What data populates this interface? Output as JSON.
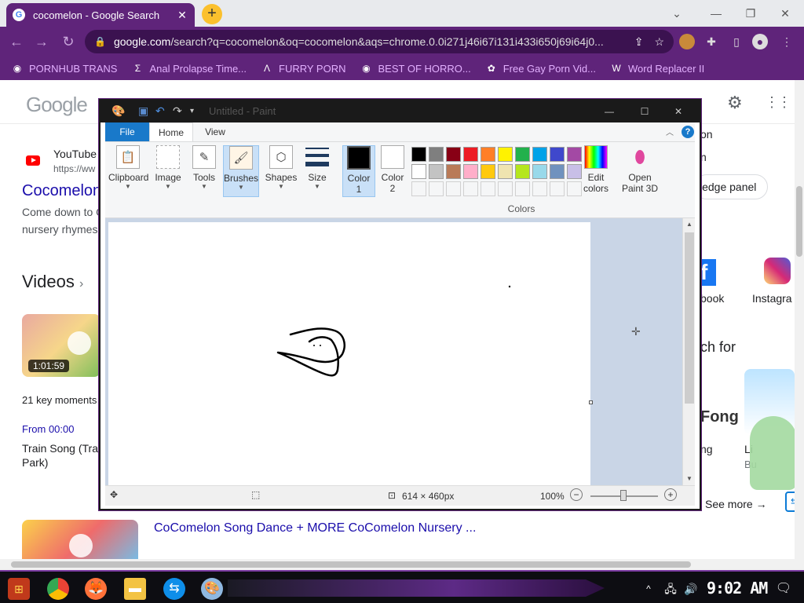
{
  "browser": {
    "tab_title": "cocomelon - Google Search",
    "tab_favicon": "G",
    "url_domain": "google.com",
    "url_path": "/search?q=cocomelon&oq=cocomelon&aqs=chrome.0.0i271j46i67i131i433i650j69i64j0...",
    "accent": "#5f247a"
  },
  "bookmarks": [
    {
      "label": "PORNHUB TRANS",
      "icon": "globe-icon"
    },
    {
      "label": "Anal Prolapse Time...",
      "icon": "sigma-icon"
    },
    {
      "label": "FURRY PORN",
      "icon": "lambda-icon"
    },
    {
      "label": "BEST OF HORRO...",
      "icon": "globe-icon"
    },
    {
      "label": "Free Gay Porn Vid...",
      "icon": "puzzle-icon"
    },
    {
      "label": "Word Replacer II",
      "icon": "wr-icon"
    }
  ],
  "google": {
    "logo": "Google",
    "result1_source": "YouTube",
    "result1_url": "https://ww",
    "result1_title": "Cocomelon",
    "result1_snippet1": "Come down to C",
    "result1_snippet2": "nursery rhymes",
    "videos_heading": "Videos",
    "video1_duration": "1:01:59",
    "key_moments": "21 key moments",
    "from_time": "From 00:00",
    "video1_title1": "Train Song (Trai",
    "video1_title2": "Park)",
    "video2_title": "CoComelon Song Dance + MORE CoComelon Nursery ...",
    "kp_on": "on",
    "kp_n": "n",
    "kp_panel": "ledge panel",
    "kp_facebook": "book",
    "kp_instagram": "Instagra",
    "kp_search_for": "ch for",
    "kp_item1a": "ng",
    "kp_item2a": "Li",
    "kp_item2b": "Bu",
    "kp_fong": "Fong",
    "kp_see_more": "See more"
  },
  "paint": {
    "title": "Untitled - Paint",
    "tabs": {
      "file": "File",
      "home": "Home",
      "view": "View"
    },
    "groups": {
      "clipboard": "Clipboard",
      "image": "Image",
      "tools": "Tools",
      "brushes": "Brushes",
      "shapes": "Shapes",
      "size": "Size",
      "color1_a": "Color",
      "color1_b": "1",
      "color2_a": "Color",
      "color2_b": "2",
      "edit_a": "Edit",
      "edit_b": "colors",
      "open_a": "Open",
      "open_b": "Paint 3D",
      "colors": "Colors"
    },
    "palette_row1": [
      "#000000",
      "#7f7f7f",
      "#880015",
      "#ed1c24",
      "#ff7f27",
      "#fff200",
      "#22b14c",
      "#00a2e8",
      "#3f48cc",
      "#a349a4"
    ],
    "palette_row2": [
      "#ffffff",
      "#c3c3c3",
      "#b97a57",
      "#ffaec9",
      "#ffc90e",
      "#efe4b0",
      "#b5e61d",
      "#99d9ea",
      "#7092be",
      "#c8bfe7"
    ],
    "canvas_size": "614 × 460px",
    "zoom": "100%"
  },
  "taskbar": {
    "clock": "9:02 AM"
  }
}
